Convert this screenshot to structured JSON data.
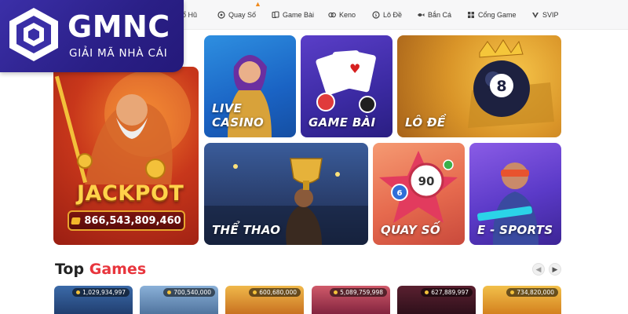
{
  "logo": {
    "title": "GMNC",
    "subtitle": "GIẢI MÃ NHÀ CÁI"
  },
  "nav": {
    "items": [
      {
        "label": "ổ Hũ",
        "icon": "slot-icon"
      },
      {
        "label": "Quay Số",
        "icon": "lottery-icon"
      },
      {
        "label": "Game Bài",
        "icon": "cards-icon"
      },
      {
        "label": "Keno",
        "icon": "keno-icon"
      },
      {
        "label": "Lô Đề",
        "icon": "lode-icon"
      },
      {
        "label": "Bắn Cá",
        "icon": "fish-icon"
      },
      {
        "label": "Cổng Game",
        "icon": "grid-icon"
      },
      {
        "label": "SVIP",
        "icon": "svip-icon"
      }
    ]
  },
  "tiles": {
    "jackpot_title": "JACKPOT",
    "jackpot_amount": "866,543,809,460",
    "live_casino": "LIVE CASINO",
    "game_bai": "GAME BÀI",
    "lo_de": "LÔ ĐỀ",
    "the_thao": "THỂ THAO",
    "quay_so": "QUAY SỐ",
    "e_sports": "E - SPORTS",
    "ball_8": "8",
    "ball_90": "90",
    "ball_6": "6"
  },
  "top_games": {
    "title_part1": "Top",
    "title_part2": "Games",
    "cards": [
      {
        "amount": "1,029,934,997"
      },
      {
        "amount": "700,540,000"
      },
      {
        "amount": "600,680,000"
      },
      {
        "amount": "5,089,759,998"
      },
      {
        "amount": "627,889,997"
      },
      {
        "amount": "734,820,000"
      }
    ]
  },
  "colors": {
    "brand": "#2a1f86",
    "accent": "#e8353d"
  }
}
